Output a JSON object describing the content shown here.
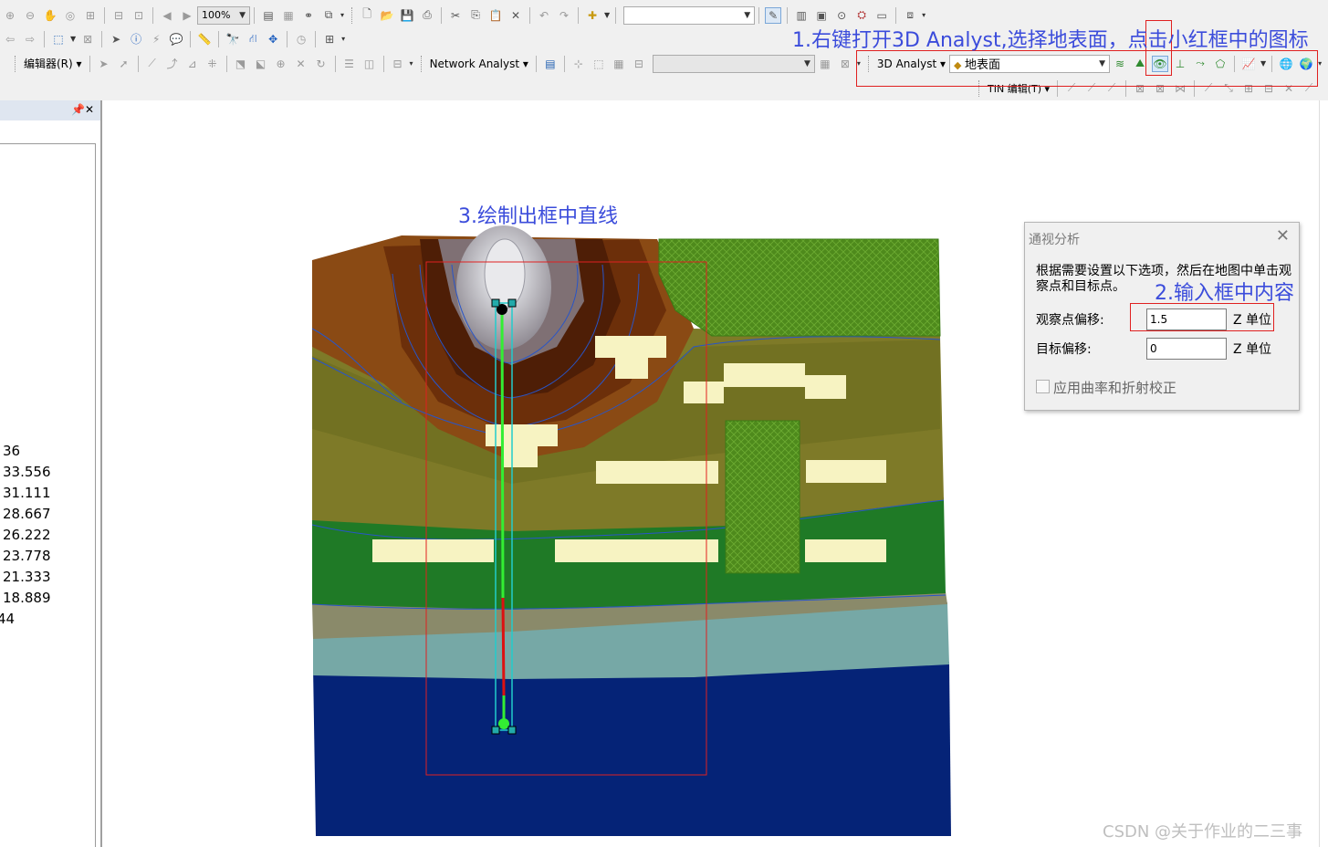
{
  "toolbar": {
    "row1": {
      "zoom_value": "100%"
    },
    "row3": {
      "editor_label": "编辑器(R)",
      "network_analyst_label": "Network Analyst",
      "analyst3d_label": "3D Analyst",
      "surface_layer_value": "地表面"
    },
    "row4": {
      "tin_edit_label": "TIN 编辑(T)"
    }
  },
  "left_panel": {
    "legend_values": [
      "36",
      "33.556",
      "31.111",
      "28.667",
      "26.222",
      "23.778",
      "21.333",
      "18.889",
      "44"
    ]
  },
  "annotations": {
    "step1": "1.右键打开3D Analyst,选择地表面，点击小红框中的图标",
    "step2": "2.输入框中内容",
    "step3": "3.绘制出框中直线"
  },
  "dialog": {
    "title": "通视分析",
    "description": "根据需要设置以下选项，然后在地图中单击观察点和目标点。",
    "observer_offset_label": "观察点偏移:",
    "observer_offset_value": "1.5",
    "target_offset_label": "目标偏移:",
    "target_offset_value": "0",
    "z_unit": "Z 单位",
    "curvature_label": "应用曲率和折射校正"
  },
  "watermark": "CSDN @关于作业的二三事",
  "colors": {
    "annotation_blue": "#3b4cdb",
    "marker_red": "#e02020",
    "visible_segment": "#33ee33",
    "hidden_segment": "#dd1111",
    "sight_line_box": "#22cccc"
  }
}
